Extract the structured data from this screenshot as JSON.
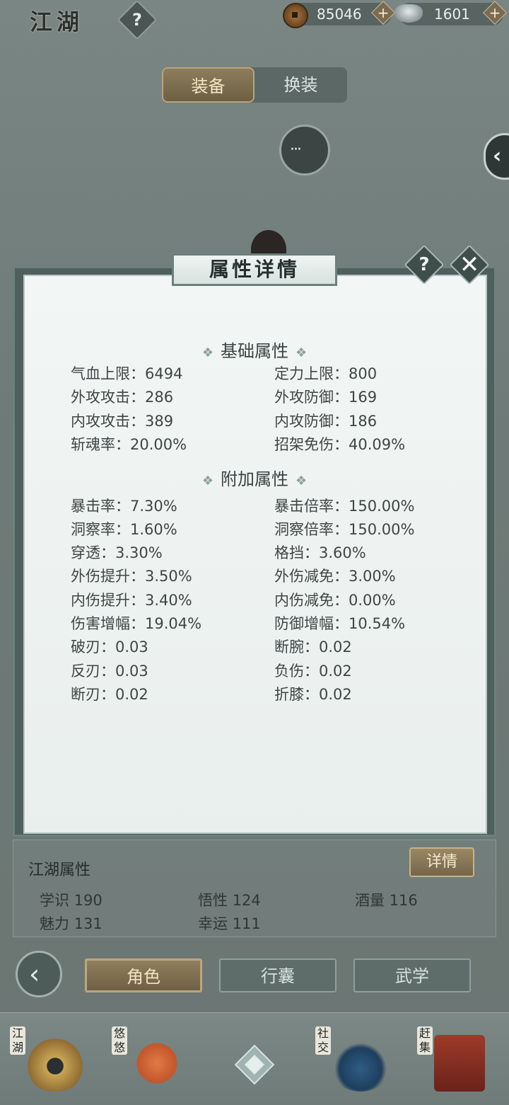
{
  "header": {
    "title": "江湖",
    "help": "?",
    "currency": [
      {
        "icon": "copper-coin-icon",
        "value": "85046",
        "add": "+"
      },
      {
        "icon": "silver-ingot-icon",
        "value": "1601",
        "add": "+"
      }
    ]
  },
  "tabs": [
    {
      "label": "装备",
      "active": true
    },
    {
      "label": "换装",
      "active": false
    }
  ],
  "chat_button": {
    "icon": "chat-bubble-icon",
    "label": "···"
  },
  "side_toggle": {
    "icon": "chevron-left-icon",
    "label": "‹"
  },
  "modal": {
    "title": "属性详情",
    "help": "?",
    "close": "✕",
    "sections": [
      {
        "title": "基础属性",
        "ornament": "❖",
        "stats": [
          [
            "气血上限：6494",
            "定力上限：800"
          ],
          [
            "外攻攻击：286",
            "外攻防御：169"
          ],
          [
            "内攻攻击：389",
            "内攻防御：186"
          ],
          [
            "斩魂率：20.00%",
            "招架免伤：40.09%"
          ]
        ]
      },
      {
        "title": "附加属性",
        "ornament": "❖",
        "stats": [
          [
            "暴击率：7.30%",
            "暴击倍率：150.00%"
          ],
          [
            "洞察率：1.60%",
            "洞察倍率：150.00%"
          ],
          [
            "穿透：3.30%",
            "格挡：3.60%"
          ],
          [
            "外伤提升：3.50%",
            "外伤减免：3.00%"
          ],
          [
            "内伤提升：3.40%",
            "内伤减免：0.00%"
          ],
          [
            "伤害增幅：19.04%",
            "防御增幅：10.54%"
          ],
          [
            "破刃：0.03",
            "断腕：0.02"
          ],
          [
            "反刃：0.03",
            "负伤：0.02"
          ],
          [
            "断刃：0.02",
            "折膝：0.02"
          ]
        ]
      }
    ]
  },
  "jianghu": {
    "title": "江湖属性",
    "detail_button": "详情",
    "stats": [
      [
        "学识",
        "190"
      ],
      [
        "悟性",
        "124"
      ],
      [
        "酒量",
        "116"
      ],
      [
        "魅力",
        "131"
      ],
      [
        "幸运",
        "111"
      ]
    ]
  },
  "bottom_tabs": [
    {
      "label": "角色",
      "active": true
    },
    {
      "label": "行囊",
      "active": false
    },
    {
      "label": "武学",
      "active": false
    }
  ],
  "back_icon": "‹",
  "nav": [
    {
      "label": "江湖",
      "icon": "straw-hat-icon"
    },
    {
      "label": "悠悠",
      "icon": "swallow-icon"
    },
    {
      "label": "",
      "icon": "compass-star-icon"
    },
    {
      "label": "社交",
      "icon": "wave-icon"
    },
    {
      "label": "赶集",
      "icon": "merchant-cart-icon"
    }
  ]
}
